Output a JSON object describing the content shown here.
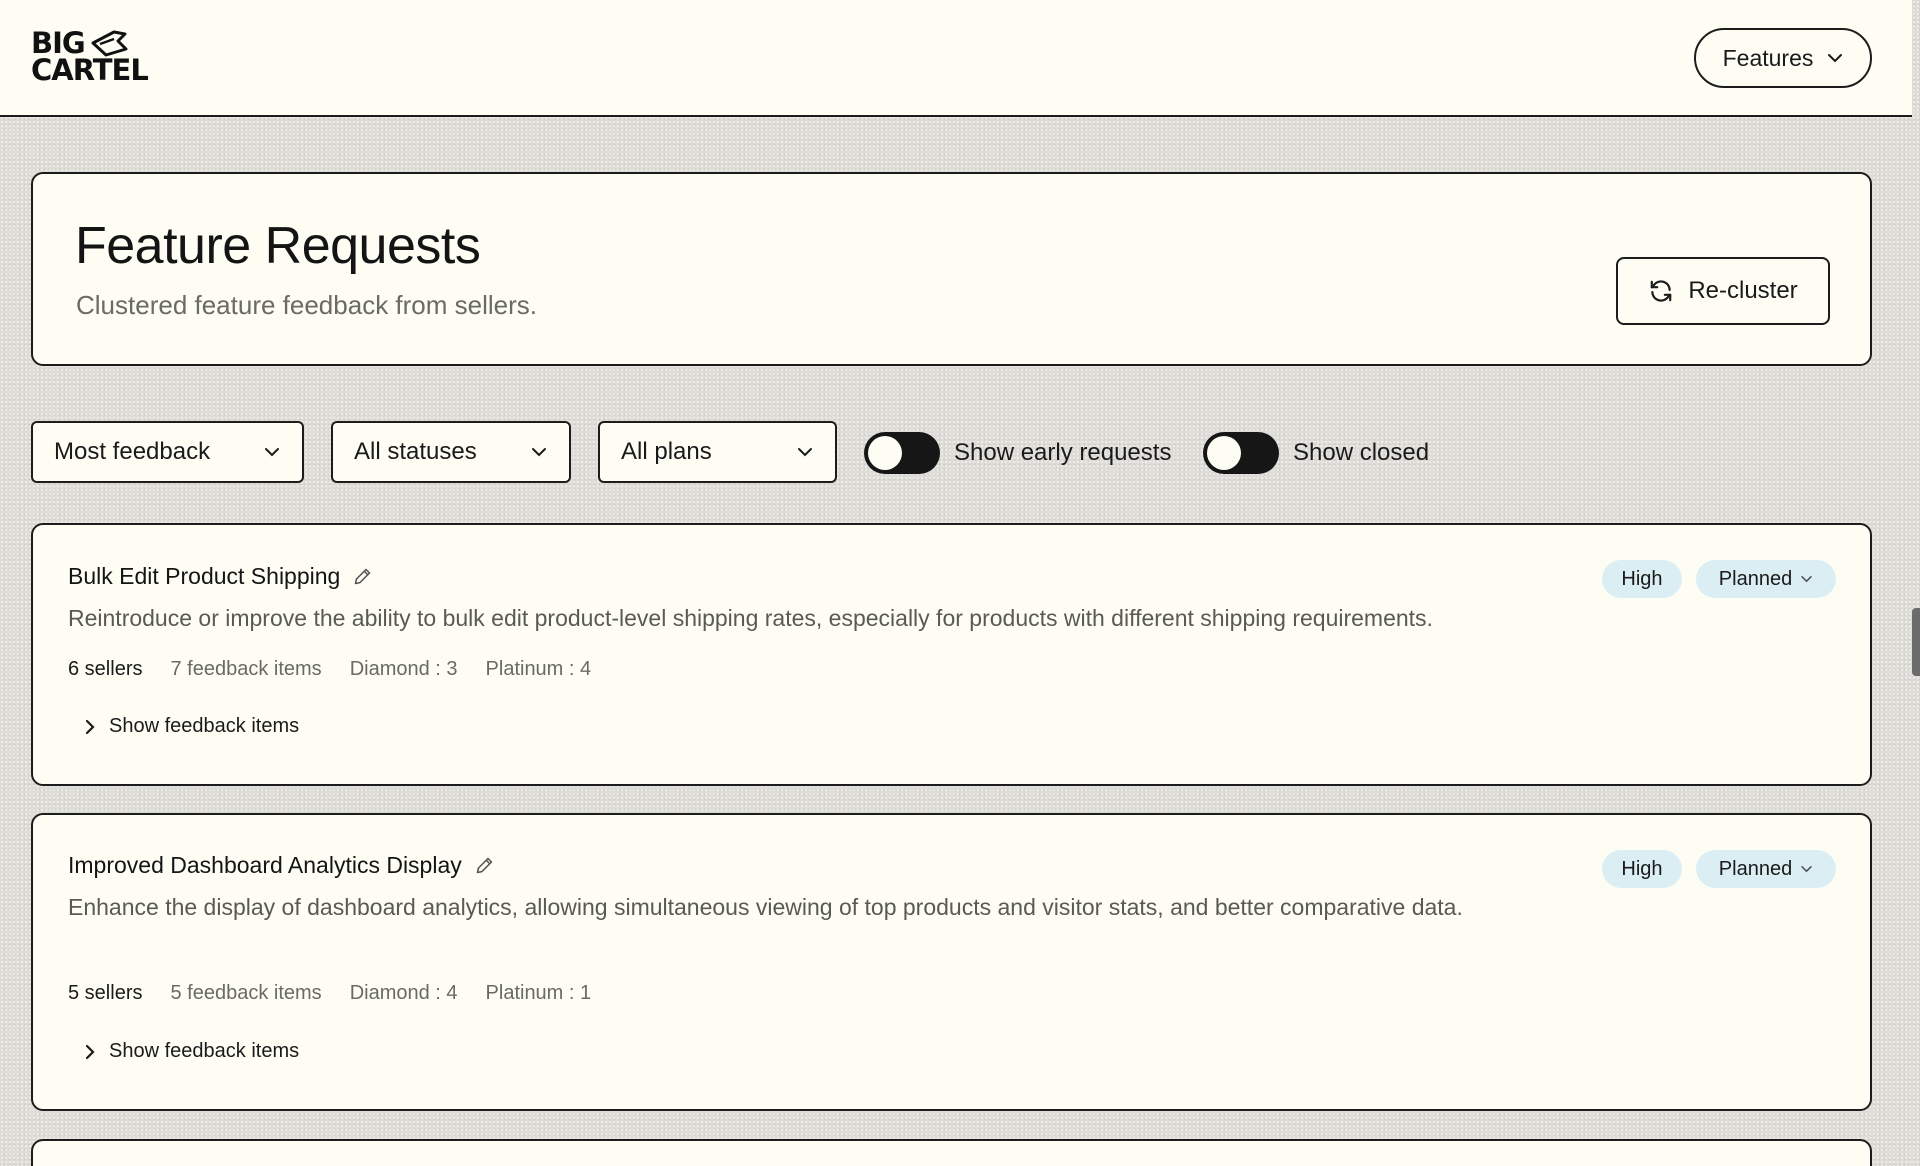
{
  "header": {
    "logo_line1": "BIG",
    "logo_line2": "CARTEL",
    "features_label": "Features"
  },
  "page": {
    "title": "Feature Requests",
    "subtitle": "Clustered feature feedback from sellers.",
    "recluster_label": "Re-cluster"
  },
  "filters": {
    "sort": "Most feedback",
    "status": "All statuses",
    "plan": "All plans",
    "toggle_early_label": "Show early requests",
    "toggle_closed_label": "Show closed"
  },
  "requests": [
    {
      "title": "Bulk Edit Product Shipping",
      "description": "Reintroduce or improve the ability to bulk edit product-level shipping rates, especially for products with different shipping requirements.",
      "sellers": "6 sellers",
      "feedback_items": "7 feedback items",
      "diamond": "Diamond : 3",
      "platinum": "Platinum : 4",
      "show_items_label": "Show feedback items",
      "priority": "High",
      "status": "Planned"
    },
    {
      "title": "Improved Dashboard Analytics Display",
      "description": "Enhance the display of dashboard analytics, allowing simultaneous viewing of top products and visitor stats, and better comparative data.",
      "sellers": "5 sellers",
      "feedback_items": "5 feedback items",
      "diamond": "Diamond : 4",
      "platinum": "Platinum : 1",
      "show_items_label": "Show feedback items",
      "priority": "High",
      "status": "Planned"
    }
  ]
}
